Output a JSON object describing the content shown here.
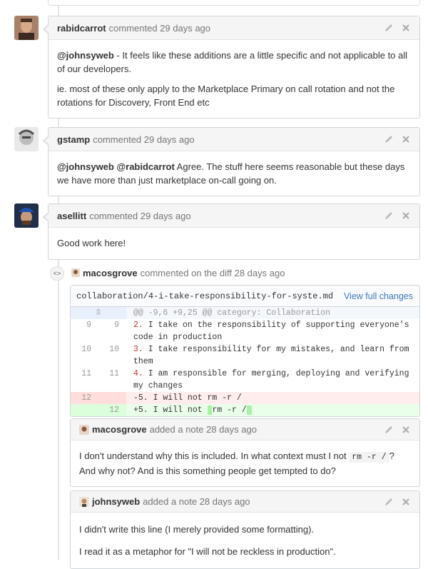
{
  "comments": [
    {
      "author": "rabidcarrot",
      "meta": "commented 29 days ago",
      "body": {
        "p1_mention": "@johnsyweb",
        "p1_text": " - It feels like these additions are a little specific and not applicable to all of our developers.",
        "p2_text": "ie. most of these only apply to the Marketplace Primary on call rotation and not the rotations for Discovery, Front End etc"
      }
    },
    {
      "author": "gstamp",
      "meta": "commented 29 days ago",
      "body": {
        "p1_mention": "@johnsyweb @rabidcarrot",
        "p1_text": " Agree. The stuff here seems reasonable but these days we have more than just marketplace on-call going on."
      }
    },
    {
      "author": "asellitt",
      "meta": "commented 29 days ago",
      "body": {
        "p1_text": "Good work here!"
      }
    }
  ],
  "diff_comment": {
    "author": "macosgrove",
    "meta": "commented on the diff 28 days ago",
    "file_name": "collaboration/4-i-take-responsibility-for-syste.md",
    "view_full_changes": "View full changes",
    "hunk": "@@ -9,6 +9,25 @@ category: Collaboration",
    "lines": [
      {
        "old": "9",
        "new": "9",
        "num": "2.",
        "text": " I take on the responsibility of supporting everyone's code in production"
      },
      {
        "old": "10",
        "new": "10",
        "num": "3.",
        "text": " I take responsibility for my mistakes, and learn from them"
      },
      {
        "old": "11",
        "new": "11",
        "num": "4.",
        "text": " I am responsible for merging, deploying and verifying my changes"
      }
    ],
    "del_line": {
      "old": "12",
      "text": "-5. I will not rm -r /"
    },
    "add_line": {
      "new": "12",
      "prefix": "+5. I will not ",
      "hl1": " ",
      "mid": "rm -r /",
      "hl2": " "
    }
  },
  "notes": [
    {
      "author": "macosgrove",
      "meta": "added a note 28 days ago",
      "text1": "I don't understand why this is included. In what context must I not ",
      "code": "rm -r /",
      "text2": "? And why not? And is this something people get tempted to do?"
    },
    {
      "author": "johnsyweb",
      "meta": "added a note 28 days ago",
      "p1": "I didn't write this line (I merely provided some formatting).",
      "p2": "I read it as a metaphor for \"I will not be reckless in production\"."
    }
  ],
  "colors": {
    "link": "#4078c0",
    "add_bg": "#eaffea",
    "del_bg": "#ffecec"
  },
  "icons": [
    "pencil-icon",
    "close-icon",
    "code-icon",
    "expand-icon"
  ]
}
